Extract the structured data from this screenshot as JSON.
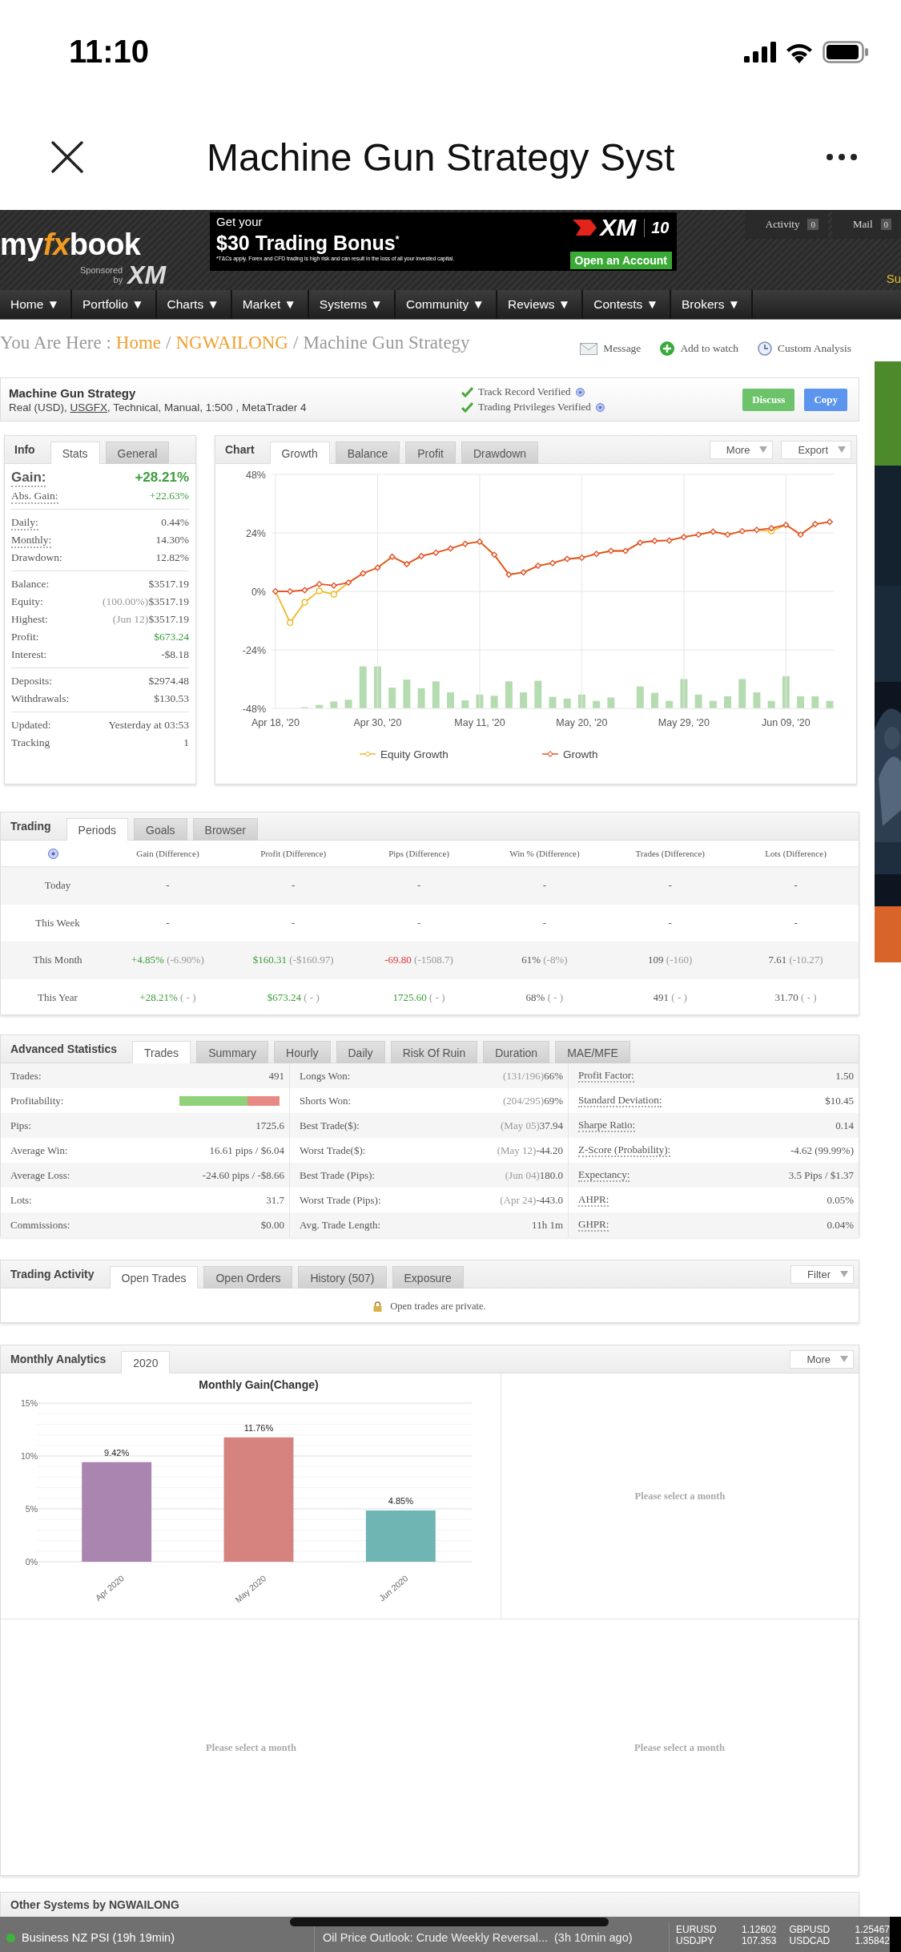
{
  "status_bar": {
    "time": "11:10"
  },
  "browser": {
    "title": "Machine Gun Strategy Syst"
  },
  "site_header": {
    "logo_start": "my",
    "logo_accent": "fx",
    "logo_end": "book",
    "sponsor_lines": [
      "Sponsored",
      "by"
    ],
    "sponsor_logo": "XM",
    "banner": {
      "intro": "Get your",
      "headline": "$30 Trading Bonus$^{*}$",
      "disclaimer": "*T&Cs apply. Forex and CFD trading is high risk and can result in the loss of all your invested capital.",
      "brand": "XM",
      "anniversary": "10",
      "button": "Open an Account"
    },
    "counters": [
      {
        "label": "Activity",
        "count": "0"
      },
      {
        "label": "Mail",
        "count": "0"
      }
    ],
    "edge_text": "Su"
  },
  "nav": [
    "Home ▼",
    "Portfolio ▼",
    "Charts ▼",
    "Market ▼",
    "Systems ▼",
    "Community ▼",
    "Reviews ▼",
    "Contests ▼",
    "Brokers ▼"
  ],
  "breadcrumb": [
    {
      "kind": "text",
      "text": "You Are Here :"
    },
    {
      "kind": "link",
      "text": "Home"
    },
    {
      "kind": "text",
      "text": "/"
    },
    {
      "kind": "link",
      "text": "NGWAILONG"
    },
    {
      "kind": "text",
      "text": "/"
    },
    {
      "kind": "text",
      "text": "Machine Gun Strategy"
    }
  ],
  "actions": [
    {
      "kind": "message",
      "label": "Message"
    },
    {
      "kind": "watch",
      "label": "Add to watch"
    },
    {
      "kind": "analysis",
      "label": "Custom Analysis"
    }
  ],
  "system": {
    "name": "Machine Gun Strategy",
    "details_before": "Real (USD),",
    "broker": "USGFX",
    "details_after": ", Technical, Manual, 1:500 , MetaTrader 4",
    "verifications": [
      "Track Record Verified",
      "Trading Privileges Verified"
    ],
    "buttons": [
      {
        "kind": "discuss",
        "label": "Discuss"
      },
      {
        "kind": "copy",
        "label": "Copy"
      }
    ]
  },
  "info": {
    "title": "Info",
    "tabs": [
      {
        "label": "Stats",
        "selected": true
      },
      {
        "label": "General",
        "selected": false
      }
    ],
    "groups": [
      [
        {
          "kind": "headline",
          "label": "Gain:",
          "value": "+28.21%",
          "positive": true,
          "hint": true
        },
        {
          "kind": "row",
          "label": "Abs. Gain:",
          "value": "+22.63%",
          "positive": true,
          "hint": true
        }
      ],
      [
        {
          "kind": "row",
          "label": "Daily:",
          "value": "0.44%",
          "positive": false,
          "hint": true
        },
        {
          "kind": "row",
          "label": "Monthly:",
          "value": "14.30%",
          "positive": false,
          "hint": true
        },
        {
          "kind": "row",
          "label": "Drawdown:",
          "value": "12.82%",
          "positive": false,
          "hint": false
        }
      ],
      [
        {
          "kind": "row",
          "label": "Balance:",
          "value": "$3517.19",
          "positive": false,
          "hint": false
        },
        {
          "kind": "row",
          "label": "Equity:",
          "note": "(100.00%)",
          "value": "$3517.19",
          "positive": false,
          "hint": false
        },
        {
          "kind": "row",
          "label": "Highest:",
          "note": "(Jun 12)",
          "value": "$3517.19",
          "positive": false,
          "hint": false
        },
        {
          "kind": "row",
          "label": "Profit:",
          "value": "$673.24",
          "positive": true,
          "hint": false
        },
        {
          "kind": "row",
          "label": "Interest:",
          "value": "-$8.18",
          "positive": false,
          "hint": false
        }
      ],
      [
        {
          "kind": "row",
          "label": "Deposits:",
          "value": "$2974.48",
          "positive": false,
          "hint": false
        },
        {
          "kind": "row",
          "label": "Withdrawals:",
          "value": "$130.53",
          "positive": false,
          "hint": false
        }
      ],
      [
        {
          "kind": "row",
          "label": "Updated:",
          "value": "Yesterday at 03:53",
          "positive": false,
          "hint": false
        },
        {
          "kind": "row",
          "label": "Tracking",
          "value": "1",
          "positive": false,
          "hint": false
        }
      ]
    ]
  },
  "chart": {
    "title": "Chart",
    "tabs": [
      {
        "label": "Growth",
        "selected": true
      },
      {
        "label": "Balance",
        "selected": false
      },
      {
        "label": "Profit",
        "selected": false
      },
      {
        "label": "Drawdown",
        "selected": false
      }
    ],
    "menus": [
      "More",
      "Export"
    ],
    "chart_data": {
      "type": "line",
      "grid": true,
      "legend": "bottom",
      "categories": [
        "Apr 18, '20",
        null,
        null,
        null,
        null,
        null,
        null,
        "Apr 30, '20",
        null,
        null,
        null,
        null,
        null,
        null,
        "May 11, '20",
        null,
        null,
        null,
        null,
        null,
        null,
        "May 20, '20",
        null,
        null,
        null,
        null,
        null,
        null,
        "May 29, '20",
        null,
        null,
        null,
        null,
        null,
        null,
        "Jun 09, '20",
        null,
        null,
        null
      ],
      "ylim": [
        -48,
        48
      ],
      "yticks": [
        {
          "value": 48,
          "label": "48%"
        },
        {
          "value": 24,
          "label": "24%"
        },
        {
          "value": 0,
          "label": "0%"
        },
        {
          "value": -24,
          "label": "-24%"
        },
        {
          "value": -48,
          "label": "-48%"
        }
      ],
      "series": [
        {
          "name": "Equity Growth",
          "color": "#f0b928",
          "values": [
            0,
            -12.8,
            -4.5,
            0.2,
            -1.2,
            3.6,
            7.4,
            9.7,
            14.2,
            11.2,
            14.5,
            15.9,
            17.6,
            19.5,
            20.4,
            15,
            6.9,
            7.8,
            10.5,
            11.6,
            13.3,
            13.8,
            15.4,
            16.6,
            16.6,
            20,
            20.7,
            20.9,
            22.3,
            23.3,
            24.5,
            23.3,
            24.7,
            25.2,
            24.7,
            27.3,
            23.3,
            27.6,
            28.5
          ]
        },
        {
          "name": "Growth",
          "color": "#e2542b",
          "marker": "diamond",
          "values": [
            0,
            0,
            0.5,
            3,
            2.4,
            3.6,
            7.4,
            9.7,
            14.2,
            11.2,
            14.5,
            15.9,
            17.6,
            19.5,
            20.4,
            15,
            6.9,
            7.8,
            10.5,
            11.6,
            13.3,
            13.8,
            15.4,
            16.6,
            16.6,
            20,
            20.7,
            20.9,
            22.3,
            23.3,
            24.5,
            23.3,
            24.7,
            25.2,
            25.9,
            27.3,
            23.3,
            27.6,
            28.5
          ]
        }
      ]
    }
  },
  "trading": {
    "title": "Trading",
    "tabs": [
      {
        "label": "Periods",
        "selected": true
      },
      {
        "label": "Goals",
        "selected": false
      },
      {
        "label": "Browser",
        "selected": false
      }
    ],
    "columns": [
      "Gain (Difference)",
      "Profit (Difference)",
      "Pips (Difference)",
      "Win % (Difference)",
      "Trades (Difference)",
      "Lots (Difference)"
    ],
    "rows": [
      {
        "period": "Today",
        "cells": [
          {
            "value": "-",
            "positive": false,
            "negative": false
          },
          {
            "value": "-",
            "positive": false,
            "negative": false
          },
          {
            "value": "-",
            "positive": false,
            "negative": false
          },
          {
            "value": "-",
            "positive": false,
            "negative": false
          },
          {
            "value": "-",
            "positive": false,
            "negative": false
          },
          {
            "value": "-",
            "positive": false,
            "negative": false
          }
        ]
      },
      {
        "period": "This Week",
        "cells": [
          {
            "value": "-",
            "positive": false,
            "negative": false
          },
          {
            "value": "-",
            "positive": false,
            "negative": false
          },
          {
            "value": "-",
            "positive": false,
            "negative": false
          },
          {
            "value": "-",
            "positive": false,
            "negative": false
          },
          {
            "value": "-",
            "positive": false,
            "negative": false
          },
          {
            "value": "-",
            "positive": false,
            "negative": false
          }
        ]
      },
      {
        "period": "This Month",
        "cells": [
          {
            "value": "+4.85%",
            "diff": "(-6.90%)",
            "positive": true,
            "negative": false
          },
          {
            "value": "$160.31",
            "diff": "(-$160.97)",
            "positive": true,
            "negative": false
          },
          {
            "value": "-69.80",
            "diff": "(-1508.7)",
            "positive": false,
            "negative": true
          },
          {
            "value": "61%",
            "diff": "(-8%)",
            "positive": false,
            "negative": false
          },
          {
            "value": "109",
            "diff": "(-160)",
            "positive": false,
            "negative": false
          },
          {
            "value": "7.61",
            "diff": "(-10.27)",
            "positive": false,
            "negative": false
          }
        ]
      },
      {
        "period": "This Year",
        "cells": [
          {
            "value": "+28.21%",
            "diff": "( - )",
            "positive": true,
            "negative": false
          },
          {
            "value": "$673.24",
            "diff": "( - )",
            "positive": true,
            "negative": false
          },
          {
            "value": "1725.60",
            "diff": "( - )",
            "positive": true,
            "negative": false
          },
          {
            "value": "68%",
            "diff": "( - )",
            "positive": false,
            "negative": false
          },
          {
            "value": "491",
            "diff": "( - )",
            "positive": false,
            "negative": false
          },
          {
            "value": "31.70",
            "diff": "( - )",
            "positive": false,
            "negative": false
          }
        ]
      }
    ]
  },
  "advanced": {
    "title": "Advanced Statistics",
    "tabs": [
      {
        "label": "Trades",
        "selected": true
      },
      {
        "label": "Summary",
        "selected": false
      },
      {
        "label": "Hourly",
        "selected": false
      },
      {
        "label": "Daily",
        "selected": false
      },
      {
        "label": "Risk Of Ruin",
        "selected": false
      },
      {
        "label": "Duration",
        "selected": false
      },
      {
        "label": "MAE/MFE",
        "selected": false
      }
    ],
    "columns": [
      [
        {
          "kind": "text",
          "label": "Trades:",
          "value": "491",
          "hint": false
        },
        {
          "kind": "bar",
          "label": "Profitability:",
          "level": 0.68,
          "hint": false
        },
        {
          "kind": "text",
          "label": "Pips:",
          "value": "1725.6",
          "hint": false
        },
        {
          "kind": "text",
          "label": "Average Win:",
          "value": "16.61 pips / $6.04",
          "hint": false
        },
        {
          "kind": "text",
          "label": "Average Loss:",
          "value": "-24.60 pips / -$8.66",
          "hint": false
        },
        {
          "kind": "text",
          "label": "Lots:",
          "value": "31.7",
          "hint": false
        },
        {
          "kind": "text",
          "label": "Commissions:",
          "value": "$0.00",
          "hint": false
        }
      ],
      [
        {
          "kind": "text",
          "label": "Longs Won:",
          "note": "(131/196)",
          "value": "66%",
          "hint": false
        },
        {
          "kind": "text",
          "label": "Shorts Won:",
          "note": "(204/295)",
          "value": "69%",
          "hint": false
        },
        {
          "kind": "text",
          "label": "Best Trade($):",
          "note": "(May 05)",
          "value": "37.94",
          "hint": false
        },
        {
          "kind": "text",
          "label": "Worst Trade($):",
          "note": "(May 12)",
          "value": "-44.20",
          "hint": false
        },
        {
          "kind": "text",
          "label": "Best Trade (Pips):",
          "note": "(Jun 04)",
          "value": "180.0",
          "hint": false
        },
        {
          "kind": "text",
          "label": "Worst Trade (Pips):",
          "note": "(Apr 24)",
          "value": "-443.0",
          "hint": false
        },
        {
          "kind": "text",
          "label": "Avg. Trade Length:",
          "value": "11h 1m",
          "hint": false
        }
      ],
      [
        {
          "kind": "text",
          "label": "Profit Factor:",
          "value": "1.50",
          "hint": true
        },
        {
          "kind": "text",
          "label": "Standard Deviation:",
          "value": "$10.45",
          "hint": true
        },
        {
          "kind": "text",
          "label": "Sharpe Ratio:",
          "value": "0.14",
          "hint": true
        },
        {
          "kind": "text",
          "label": "Z-Score (Probability):",
          "value": "-4.62 (99.99%)",
          "hint": true
        },
        {
          "kind": "text",
          "label": "Expectancy:",
          "value": "3.5 Pips / $1.37",
          "hint": true
        },
        {
          "kind": "text",
          "label": "AHPR:",
          "value": "0.05%",
          "hint": true
        },
        {
          "kind": "text",
          "label": "GHPR:",
          "value": "0.04%",
          "hint": true
        }
      ]
    ]
  },
  "activity": {
    "title": "Trading Activity",
    "tabs": [
      {
        "label": "Open Trades",
        "selected": true
      },
      {
        "label": "Open Orders",
        "selected": false
      },
      {
        "label": "History (507)",
        "selected": false
      },
      {
        "label": "Exposure",
        "selected": false
      }
    ],
    "menu": "Filter",
    "message": "Open trades are private."
  },
  "monthly": {
    "title": "Monthly Analytics",
    "tabs": [
      {
        "label": "2020",
        "selected": true
      }
    ],
    "menu": "More",
    "chart_data": {
      "type": "bar",
      "title": "Monthly Gain(Change)",
      "categories": [
        "Apr 2020",
        "May 2020",
        "Jun 2020"
      ],
      "values": [
        9.42,
        11.76,
        4.85
      ],
      "value_labels": [
        "9.42%",
        "11.76%",
        "4.85%"
      ],
      "ylim": [
        0,
        15
      ],
      "yticks": [
        {
          "value": 0,
          "label": "0%"
        },
        {
          "value": 5,
          "label": "5%"
        },
        {
          "value": 10,
          "label": "10%"
        },
        {
          "value": 15,
          "label": "15%"
        }
      ]
    },
    "placeholders": [
      "Please select a month",
      "Please select a month",
      "Please select a month"
    ]
  },
  "other_systems": {
    "title": "Other Systems by NGWAILONG"
  },
  "ticker": {
    "event": {
      "text": "Business NZ PSI (19h 19min)",
      "color": "#3db53d"
    },
    "news": {
      "title": "Oil Price Outlook: Crude Weekly Reversal...",
      "age": "(3h 10min ago)"
    },
    "quotes": [
      {
        "symbol": "EURUSD",
        "price": "1.12602"
      },
      {
        "symbol": "GBPUSD",
        "price": "1.25467"
      },
      {
        "symbol": "USDJPY",
        "price": "107.353"
      },
      {
        "symbol": "USDCAD",
        "price": "1.35842"
      }
    ]
  }
}
